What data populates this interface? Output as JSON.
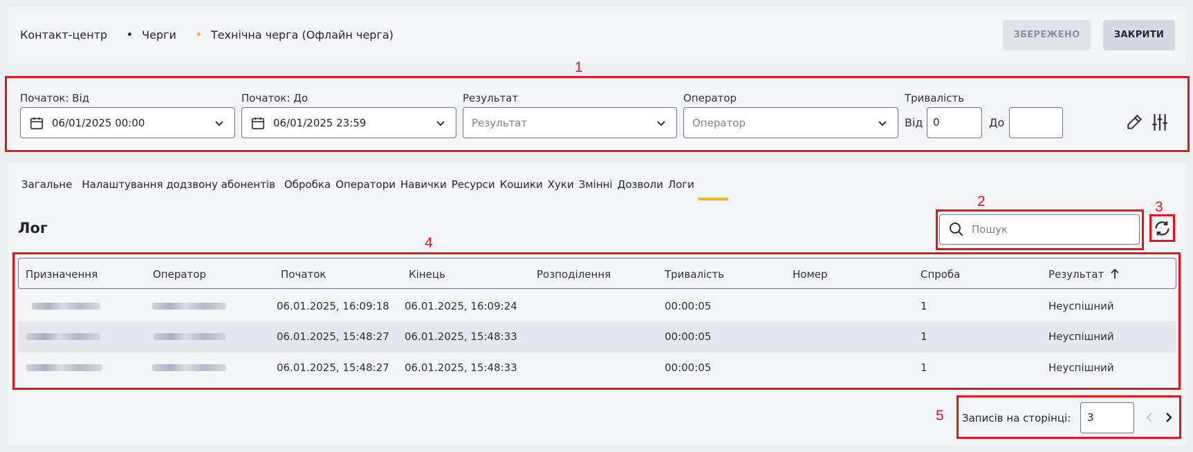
{
  "breadcrumbs": [
    "Контакт-центр",
    "Черги",
    "Технічна черга (Офлайн черга)"
  ],
  "breadcrumb_dot_colors": [
    "#2b2e3d",
    "#f0b323"
  ],
  "header_buttons": {
    "saved": "ЗБЕРЕЖЕНО",
    "close": "ЗАКРИТИ"
  },
  "annotations": [
    "1",
    "2",
    "3",
    "4",
    "5"
  ],
  "annotation_color": "#e2161b",
  "filters": {
    "start_from": {
      "label": "Початок: Від",
      "value": "06/01/2025 00:00"
    },
    "start_to": {
      "label": "Початок: До",
      "value": "06/01/2025 23:59"
    },
    "result": {
      "label": "Результат",
      "placeholder": "Результат"
    },
    "operator": {
      "label": "Оператор",
      "placeholder": "Оператор"
    },
    "duration": {
      "label": "Тривалість",
      "from_label": "Від",
      "from_value": "0",
      "to_label": "До",
      "to_value": ""
    }
  },
  "tabs": [
    "Загальне",
    "Налаштування додзвону абонентів",
    "Обробка",
    "Оператори",
    "Навички",
    "Ресурси",
    "Кошики",
    "Хуки",
    "Змінні",
    "Дозволи",
    "Логи"
  ],
  "active_tab": "Логи",
  "accent_color": "#f0b323",
  "log": {
    "title": "Лог",
    "search_placeholder": "Пошук",
    "columns": [
      "Призначення",
      "Оператор",
      "Початок",
      "Кінець",
      "Розподілення",
      "Тривалість",
      "Номер",
      "Спроба",
      "Результат"
    ],
    "sort_icon": "arrow-up-icon",
    "rows": [
      {
        "start": "06.01.2025, 16:09:18",
        "end": "06.01.2025, 16:09:24",
        "distribution": "",
        "duration": "00:00:05",
        "number": "",
        "attempt": "1",
        "result": "Неуспішний"
      },
      {
        "start": "06.01.2025, 15:48:27",
        "end": "06.01.2025, 15:48:33",
        "distribution": "",
        "duration": "00:00:05",
        "number": "",
        "attempt": "1",
        "result": "Неуспішний"
      },
      {
        "start": "06.01.2025, 15:48:27",
        "end": "06.01.2025, 15:48:33",
        "distribution": "",
        "duration": "00:00:05",
        "number": "",
        "attempt": "1",
        "result": "Неуспішний"
      }
    ]
  },
  "pagination": {
    "label": "Записів на сторінці:",
    "page_size": "3"
  }
}
